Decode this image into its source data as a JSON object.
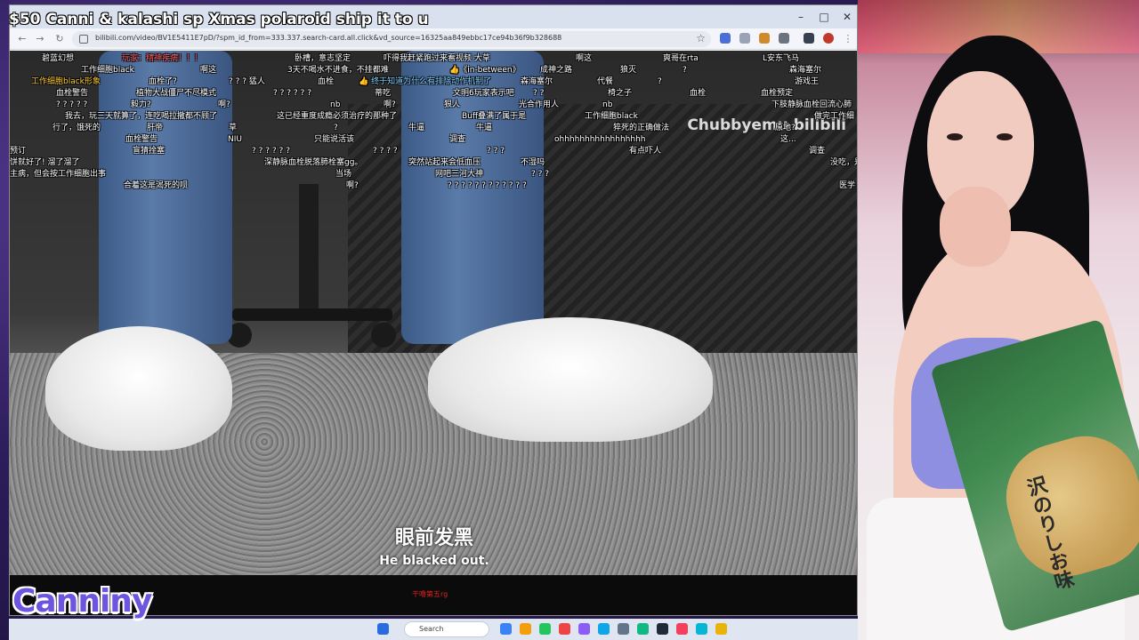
{
  "stream_overlay": {
    "donation_text": "$50  Canni & kalashi sp Xmas polaroid ship it to u",
    "channel_logo": "Canniny"
  },
  "browser": {
    "window_controls": [
      "–",
      "□",
      "✕"
    ],
    "url": "bilibili.com/video/BV1E5411E7pD/?spm_id_from=333.337.search-card.all.click&vd_source=16325aa849ebbc17ce94b36f9b328688",
    "nav_icons": [
      "back-icon",
      "forward-icon",
      "reload-icon"
    ]
  },
  "video": {
    "subtitle_zh": "眼前发黑",
    "subtitle_en": "He blacked out.",
    "watermark": "Chubbyemu bilibili",
    "bottom_red_text": "干噜第五rg",
    "danmaku": [
      {
        "text": "碧蓝幻想",
        "color": "#ffffff"
      },
      {
        "text": "玩家：精神疾病！！！",
        "color": "#ff5a5a"
      },
      {
        "text": "卧槽，意志坚定",
        "color": "#ffffff"
      },
      {
        "text": "吓得我赶紧跑过来看视频  大草",
        "color": "#ffffff"
      },
      {
        "text": "啊这",
        "color": "#ffffff"
      },
      {
        "text": "爽哥在rta",
        "color": "#ffffff"
      },
      {
        "text": "L安东飞马",
        "color": "#ffffff"
      },
      {
        "text": "工作细胞black",
        "color": "#ffffff"
      },
      {
        "text": "啊这",
        "color": "#ffffff"
      },
      {
        "text": "3天不喝水不进食，不挂都难",
        "color": "#ffffff"
      },
      {
        "text": "👍《in-between》",
        "color": "#ffffff"
      },
      {
        "text": "成神之路",
        "color": "#ffffff"
      },
      {
        "text": "狼灭",
        "color": "#ffffff"
      },
      {
        "text": "?",
        "color": "#ffffff"
      },
      {
        "text": "森海塞尔",
        "color": "#ffffff"
      },
      {
        "text": "工作细胞black形象",
        "color": "#ffcc33"
      },
      {
        "text": "血栓了?",
        "color": "#ffffff"
      },
      {
        "text": "? ? ? 猛人",
        "color": "#ffffff"
      },
      {
        "text": "血栓",
        "color": "#ffffff"
      },
      {
        "text": "👍 终于知道为什么有排除动作机制了",
        "color": "#7fd0ff"
      },
      {
        "text": "森海塞尔",
        "color": "#ffffff"
      },
      {
        "text": "代餐",
        "color": "#ffffff"
      },
      {
        "text": "?",
        "color": "#ffffff"
      },
      {
        "text": "游戏王",
        "color": "#ffffff"
      },
      {
        "text": "血栓警告",
        "color": "#ffffff"
      },
      {
        "text": "植物大战僵尸不尽模式",
        "color": "#ffffff"
      },
      {
        "text": "? ? ? ? ? ?",
        "color": "#ffffff"
      },
      {
        "text": "蒂吃",
        "color": "#ffffff"
      },
      {
        "text": "文明6玩家表示吧",
        "color": "#ffffff"
      },
      {
        "text": "? ?",
        "color": "#ffffff"
      },
      {
        "text": "椅之子",
        "color": "#ffffff"
      },
      {
        "text": "血栓",
        "color": "#ffffff"
      },
      {
        "text": "血栓预定",
        "color": "#ffffff"
      },
      {
        "text": "? ? ? ? ?",
        "color": "#ffffff"
      },
      {
        "text": "毅力?",
        "color": "#ffffff"
      },
      {
        "text": "啊?",
        "color": "#ffffff"
      },
      {
        "text": "nb",
        "color": "#ffffff"
      },
      {
        "text": "啊?",
        "color": "#ffffff"
      },
      {
        "text": "狠人",
        "color": "#ffffff"
      },
      {
        "text": "光合作用人",
        "color": "#ffffff"
      },
      {
        "text": "nb",
        "color": "#ffffff"
      },
      {
        "text": "下肢静脉血栓回流心肺",
        "color": "#ffffff"
      },
      {
        "text": "我去，玩三天就算了，连吃喝拉撒都不顾了",
        "color": "#ffffff"
      },
      {
        "text": "这已经重度成瘾必须治疗的那种了",
        "color": "#ffffff"
      },
      {
        "text": "Buff叠满了属于是",
        "color": "#ffffff"
      },
      {
        "text": "工作细胞black",
        "color": "#ffffff"
      },
      {
        "text": "做完工作细",
        "color": "#ffffff"
      },
      {
        "text": "行了，饿死的",
        "color": "#ffffff"
      },
      {
        "text": "肝帝",
        "color": "#ffffff"
      },
      {
        "text": "草",
        "color": "#ffffff"
      },
      {
        "text": "?",
        "color": "#ffffff"
      },
      {
        "text": "牛逼",
        "color": "#ffffff"
      },
      {
        "text": "牛逼",
        "color": "#ffffff"
      },
      {
        "text": "猝死的正确做法",
        "color": "#ffffff"
      },
      {
        "text": "原地?",
        "color": "#ffffff"
      },
      {
        "text": "血栓警告",
        "color": "#ffffff"
      },
      {
        "text": "NIU",
        "color": "#ffffff"
      },
      {
        "text": "只能说活该",
        "color": "#ffffff"
      },
      {
        "text": "调查",
        "color": "#ffffff"
      },
      {
        "text": "ohhhhhhhhhhhhhhhhh",
        "color": "#ffffff"
      },
      {
        "text": "这...",
        "color": "#ffffff"
      },
      {
        "text": "预订",
        "color": "#ffffff"
      },
      {
        "text": "盲猜拴塞",
        "color": "#ffffff"
      },
      {
        "text": "? ? ? ? ? ?",
        "color": "#ffffff"
      },
      {
        "text": "? ? ? ?",
        "color": "#ffffff"
      },
      {
        "text": "? ? ?",
        "color": "#ffffff"
      },
      {
        "text": "有点吓人",
        "color": "#ffffff"
      },
      {
        "text": "调查",
        "color": "#ffffff"
      },
      {
        "text": "饼就好了! 溜了溜了",
        "color": "#ffffff"
      },
      {
        "text": "深静脉血栓脱落肺栓塞gg。",
        "color": "#ffffff"
      },
      {
        "text": "突然站起来会低血压",
        "color": "#ffffff"
      },
      {
        "text": "不湿吗",
        "color": "#ffffff"
      },
      {
        "text": "没吃，是饿的",
        "color": "#ffffff"
      },
      {
        "text": "主病，但会按工作细胞出事",
        "color": "#ffffff"
      },
      {
        "text": "当场",
        "color": "#ffffff"
      },
      {
        "text": "网吧三河大神",
        "color": "#ffffff"
      },
      {
        "text": "? ? ?",
        "color": "#ffffff"
      },
      {
        "text": "合着这是渴死的呗",
        "color": "#ffffff"
      },
      {
        "text": "啊?",
        "color": "#ffffff"
      },
      {
        "text": "? ? ? ? ? ? ? ? ? ? ? ?",
        "color": "#ffffff"
      },
      {
        "text": "医学",
        "color": "#ffffff"
      }
    ]
  },
  "taskbar": {
    "search_placeholder": "Search",
    "colors": [
      "#3b82f6",
      "#f59e0b",
      "#22c55e",
      "#ef4444",
      "#8b5cf6",
      "#0ea5e9",
      "#64748b",
      "#10b981",
      "#1f2937",
      "#f43f5e",
      "#06b6d4",
      "#eab308"
    ]
  },
  "webcam": {
    "bag_label": "沢のりしお味"
  }
}
